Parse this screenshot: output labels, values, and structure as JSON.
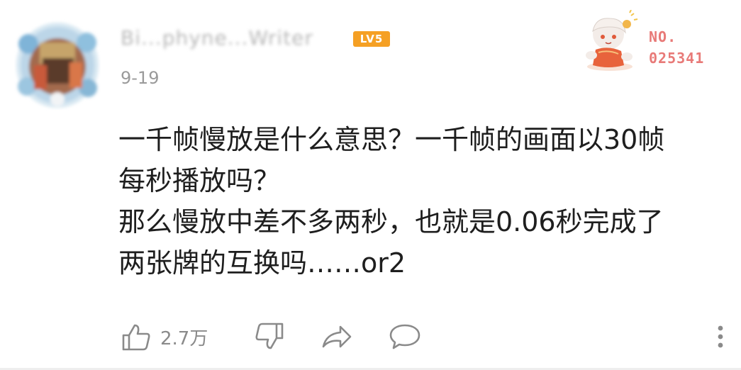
{
  "comment": {
    "user": {
      "name": "Bi...phyne...Writer",
      "level_badge": "LV5",
      "avatar": "blurred-profile-avatar"
    },
    "date": "9-19",
    "fan_badge": {
      "label": "NO.",
      "number": "025341"
    },
    "text_lines": [
      "一千帧慢放是什么意思？一千帧的画面以30帧",
      "每秒播放吗？",
      "那么慢放中差不多两秒，也就是0.06秒完成了",
      "两张牌的互换吗……or2"
    ],
    "actions": {
      "like_count": "2.7万",
      "icons": [
        "thumbs-up-icon",
        "thumbs-down-icon",
        "share-icon",
        "reply-icon",
        "more-icon"
      ]
    }
  },
  "colors": {
    "text": "#1e1e1e",
    "muted": "#9a9a9a",
    "level_badge": "#f5a024",
    "fan_badge_text": "#e87a78"
  }
}
